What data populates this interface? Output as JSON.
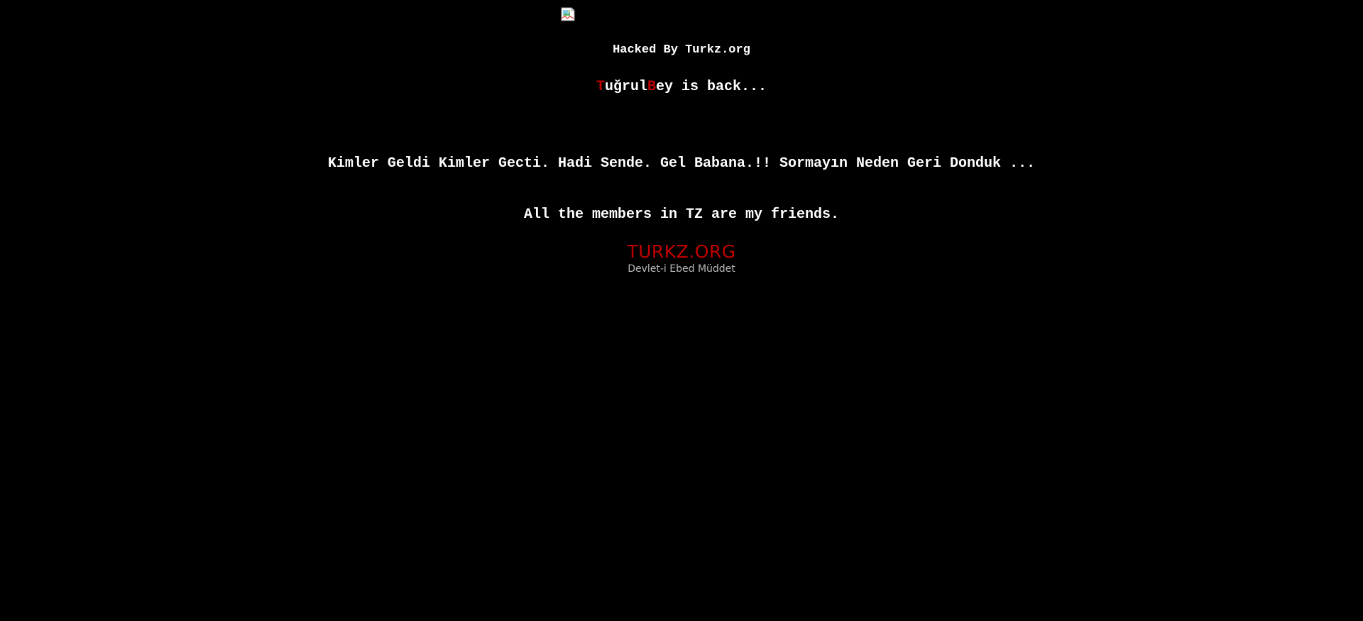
{
  "colors": {
    "background": "#000000",
    "text": "#ffffff",
    "accent_red": "#c00000",
    "tagline_gray": "#b8b8b8"
  },
  "broken_image": {
    "icon": "broken-image-icon"
  },
  "headline": "Hacked By Turkz.org",
  "signature": {
    "first_letter": "T",
    "name_part_1": "uğrul",
    "second_letter": "B",
    "name_part_2": "ey",
    "suffix": " is back..."
  },
  "message": "Kimler Geldi Kimler Gecti. Hadi Sende. Gel Babana.!! Sormayın Neden Geri Donduk ...",
  "friends_line": "All the members in TZ are my friends.",
  "logo": {
    "title": "TURKZ.ORG",
    "tagline": "Devlet-i Ebed Müddet"
  }
}
